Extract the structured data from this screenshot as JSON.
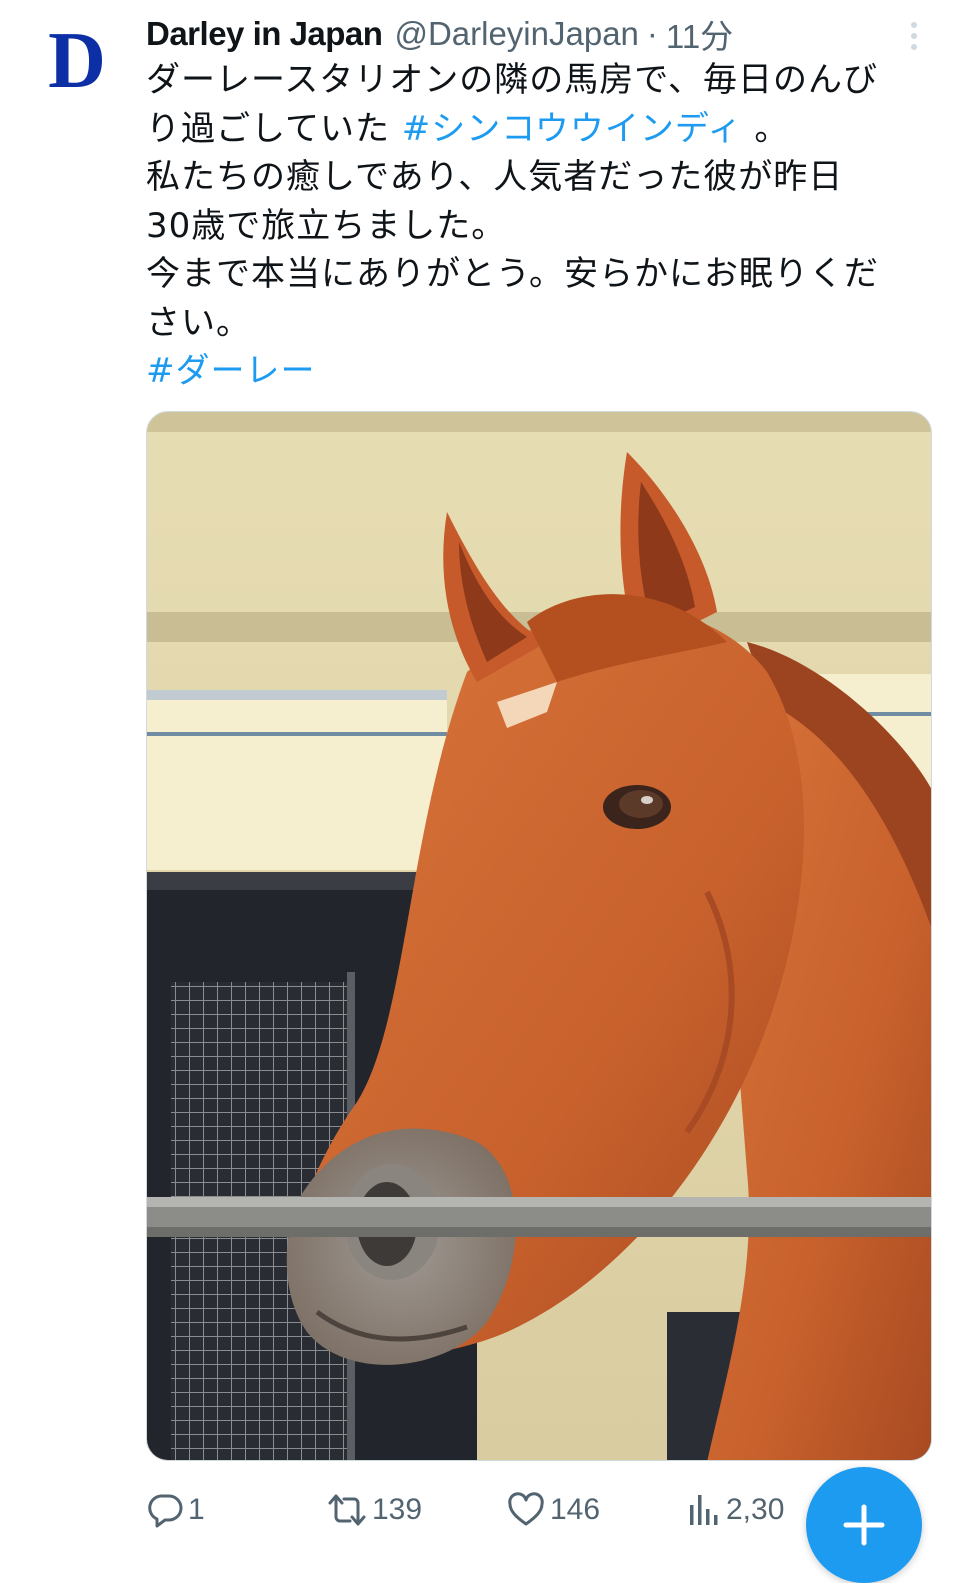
{
  "account": {
    "avatar_letter": "D",
    "display_name": "Darley in Japan",
    "handle": "@DarleyinJapan",
    "separator": "·",
    "time": "11分"
  },
  "tweet": {
    "line1": "ダーレースタリオンの隣の馬房で、毎日のんび",
    "line2_prefix": "り過ごしていた ",
    "line2_hashtag": "#シンコウウインディ",
    "line2_suffix": " 。",
    "line3": "私たちの癒しであり、人気者だった彼が昨日",
    "line4": "30歳で旅立ちました。",
    "line5": "今まで本当にありがとう。安らかにお眠りくだ",
    "line6": "さい。",
    "hashtag2": "#ダーレー"
  },
  "actions": {
    "reply_count": "1",
    "retweet_count": "139",
    "like_count": "146",
    "views_count": "2,30"
  },
  "icons": {
    "more": "more-vertical-icon",
    "reply": "reply-icon",
    "retweet": "retweet-icon",
    "like": "heart-icon",
    "views": "views-icon",
    "compose": "plus-icon"
  },
  "colors": {
    "accent": "#1d9bf0",
    "avatar_letter": "#0d2fa6",
    "muted_text": "#536471"
  }
}
